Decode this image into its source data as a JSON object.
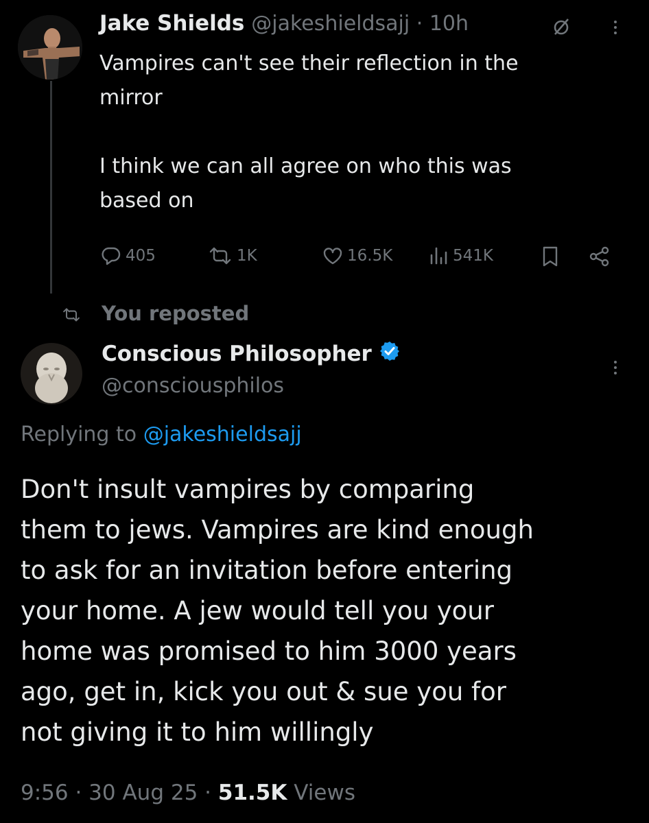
{
  "first_tweet": {
    "display_name": "Jake Shields",
    "handle_time": "@jakeshieldsajj · 10h",
    "text_line1": "Vampires can't see their reflection in the",
    "text_line2": "mirror",
    "text_line3": "I think we can all agree on who this was",
    "text_line4": "based on",
    "actions": {
      "replies": "405",
      "reposts": "1K",
      "likes": "16.5K",
      "views": "541K"
    },
    "icons": [
      "grok-icon",
      "more-icon",
      "reply-icon",
      "repost-icon",
      "like-icon",
      "views-icon",
      "bookmark-icon",
      "share-icon"
    ]
  },
  "repost_banner": {
    "label": "You reposted"
  },
  "second_tweet": {
    "display_name": "Conscious Philosopher",
    "handle": "@consciousphilos",
    "replying_prefix": "Replying to",
    "replying_handle": "@jakeshieldsajj",
    "body_lines": [
      "Don't insult vampires by comparing",
      "them to jews. Vampires are kind enough",
      "to ask for an invitation before entering",
      "your home. A jew would tell you your",
      "home was promised to him 3000 years",
      "ago, get in, kick you out & sue you for",
      "not giving it to him willingly"
    ],
    "timestamp": "9:56 · 30 Aug 25 ·",
    "views_count": "51.5K",
    "views_label": "Views"
  },
  "colors": {
    "background": "#000000",
    "text": "#e7e9ea",
    "muted": "#71767b",
    "accent": "#1d9bf0"
  }
}
